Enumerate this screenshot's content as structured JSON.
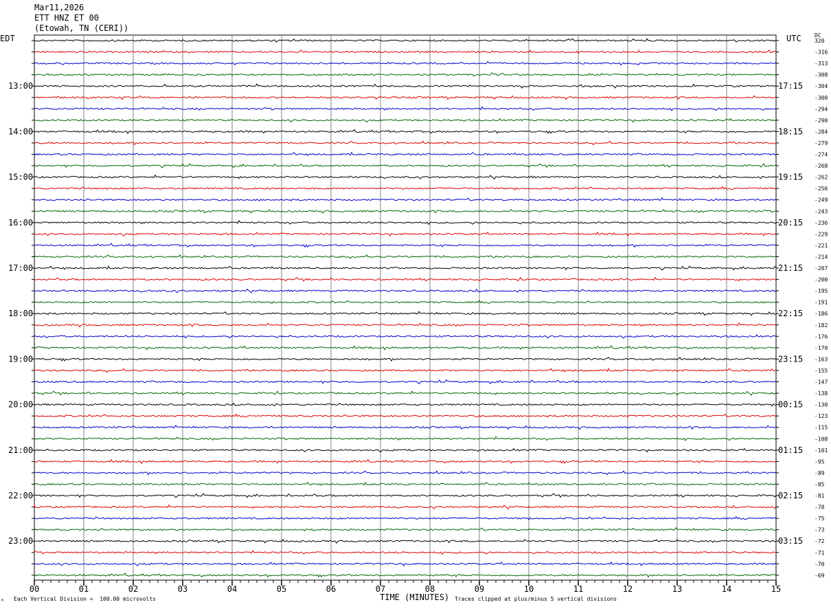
{
  "header": {
    "date": "Mar11,2026",
    "station": "ETT HNZ ET 00",
    "location": "(Etowah, TN (CERI))"
  },
  "corner_labels": {
    "left": "EDT",
    "right": "UTC",
    "dc": "DC"
  },
  "footer": {
    "vertical_division": "Each Vertical Division =  100.00 microvolts",
    "clip_note": "Traces clipped at plus/minus 5 vertical divisions",
    "logo": "ᴹ"
  },
  "colors": {
    "trace_cycle": [
      "#000000",
      "#dd0000",
      "#0000cc",
      "#006600"
    ],
    "grid": "#808080"
  },
  "chart_data": {
    "type": "line",
    "title": "",
    "xlabel": "TIME (MINUTES)",
    "xlim": [
      0,
      15
    ],
    "x_ticks": [
      "00",
      "01",
      "02",
      "03",
      "04",
      "05",
      "06",
      "07",
      "08",
      "09",
      "10",
      "11",
      "12",
      "13",
      "14",
      "15"
    ],
    "trace_count": 48,
    "trace_minutes": 15,
    "left_hour_labels": [
      "13:00",
      "14:00",
      "15:00",
      "16:00",
      "17:00",
      "18:00",
      "19:00",
      "20:00",
      "21:00",
      "22:00",
      "23:00"
    ],
    "right_hour_labels": [
      "17:15",
      "18:15",
      "19:15",
      "20:15",
      "21:15",
      "22:15",
      "23:15",
      "00:15",
      "01:15",
      "02:15",
      "03:15"
    ],
    "hour_label_first_trace": 4,
    "hour_label_step": 4,
    "dc_offsets": [
      "320",
      "-316",
      "-313",
      "-308",
      "-304",
      "-300",
      "-294",
      "-290",
      "-284",
      "-279",
      "-274",
      "-268",
      "-262",
      "-256",
      "-249",
      "-243",
      "-236",
      "-229",
      "-221",
      "-214",
      "-207",
      "-200",
      "-195",
      "-191",
      "-186",
      "-182",
      "-176",
      "-170",
      "-163",
      "-155",
      "-147",
      "-138",
      "-130",
      "-123",
      "-115",
      "-108",
      "-101",
      "-95",
      "-89",
      "-85",
      "-81",
      "-78",
      "-75",
      "-73",
      "-72",
      "-71",
      "-70",
      "-69"
    ]
  }
}
